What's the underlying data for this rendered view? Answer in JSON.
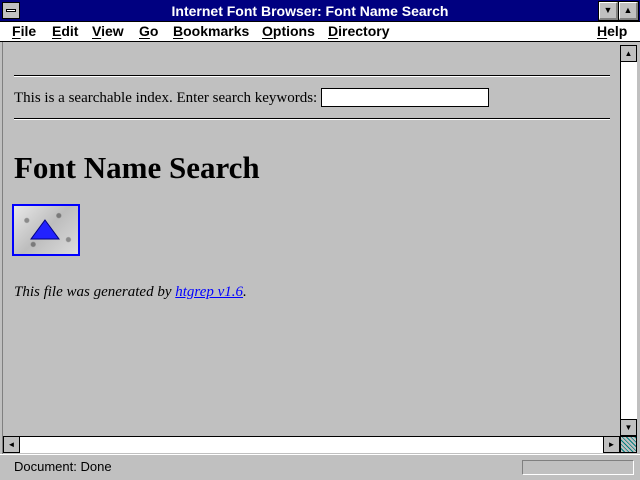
{
  "window": {
    "title": "Internet Font Browser: Font Name Search"
  },
  "menubar": {
    "items": [
      {
        "label": "File"
      },
      {
        "label": "Edit"
      },
      {
        "label": "View"
      },
      {
        "label": "Go"
      },
      {
        "label": "Bookmarks"
      },
      {
        "label": "Options"
      },
      {
        "label": "Directory"
      },
      {
        "label": "Help"
      }
    ]
  },
  "content": {
    "search_prompt": "This is a searchable index. Enter search keywords:",
    "search_value": "",
    "heading": "Font Name Search",
    "generated_prefix": "This file was generated by ",
    "generated_link": "htgrep v1.6",
    "generated_suffix": "."
  },
  "statusbar": {
    "text": "Document: Done"
  },
  "colors": {
    "titlebar": "#000080",
    "background": "#c0c0c0",
    "link": "#0000ff"
  },
  "icons": {
    "up_button": "up-triangle-icon",
    "minimize": "minimize-icon",
    "maximize": "maximize-icon",
    "system_menu": "system-menu-icon"
  }
}
